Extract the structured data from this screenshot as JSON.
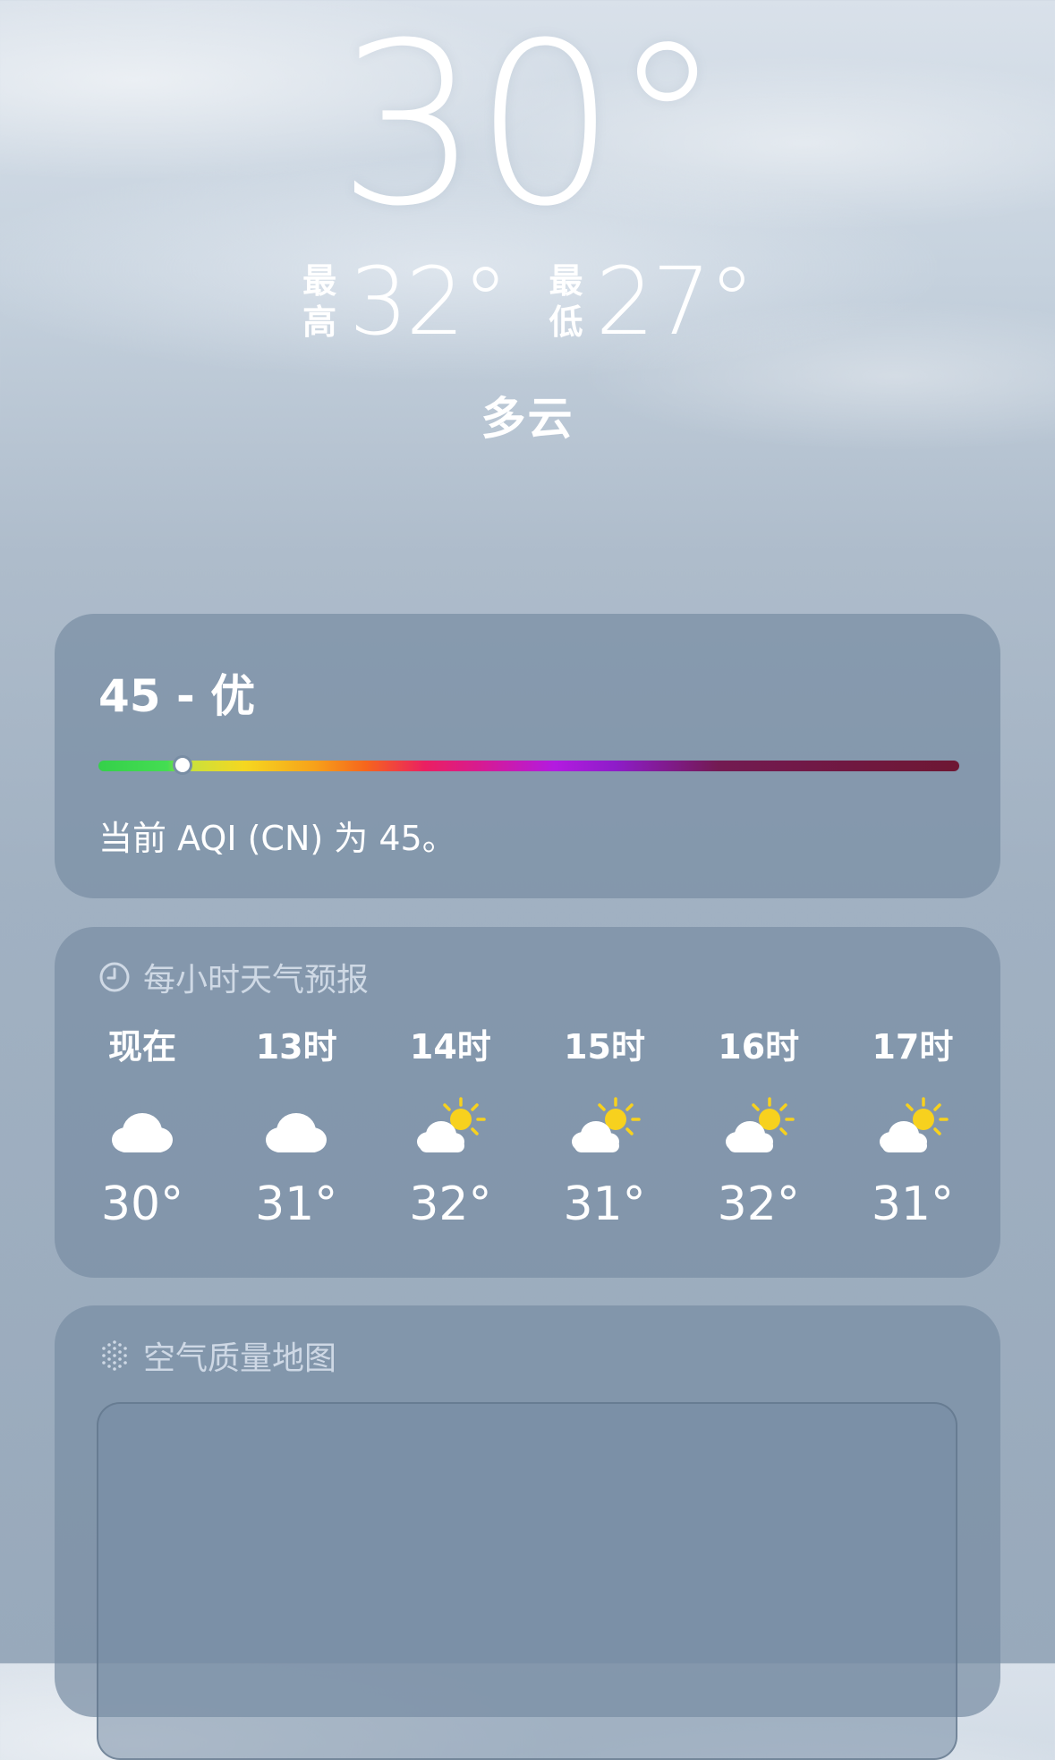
{
  "hero": {
    "current_temp": "30°",
    "high_label_1": "最",
    "high_label_2": "高",
    "high_value": "32°",
    "low_label_1": "最",
    "low_label_2": "低",
    "low_value": "27°",
    "condition": "多云"
  },
  "aqi": {
    "headline": "45 - 优",
    "description": "当前 AQI (CN) 为 45。",
    "indicator_fraction": 0.095
  },
  "hourly": {
    "title": "每小时天气预报",
    "header_icon": "clock-icon",
    "items": [
      {
        "label": "现在",
        "icon": "cloud-icon",
        "temp": "30°"
      },
      {
        "label": "13时",
        "icon": "cloud-icon",
        "temp": "31°"
      },
      {
        "label": "14时",
        "icon": "partly-sunny-icon",
        "temp": "32°"
      },
      {
        "label": "15时",
        "icon": "partly-sunny-icon",
        "temp": "31°"
      },
      {
        "label": "16时",
        "icon": "partly-sunny-icon",
        "temp": "32°"
      },
      {
        "label": "17时",
        "icon": "partly-sunny-icon",
        "temp": "31°"
      }
    ]
  },
  "air_map": {
    "title": "空气质量地图",
    "header_icon": "dots-grid-icon"
  },
  "colors": {
    "card_bg": "#788da4",
    "sun": "#f7d11e",
    "cloud": "#ffffff"
  }
}
